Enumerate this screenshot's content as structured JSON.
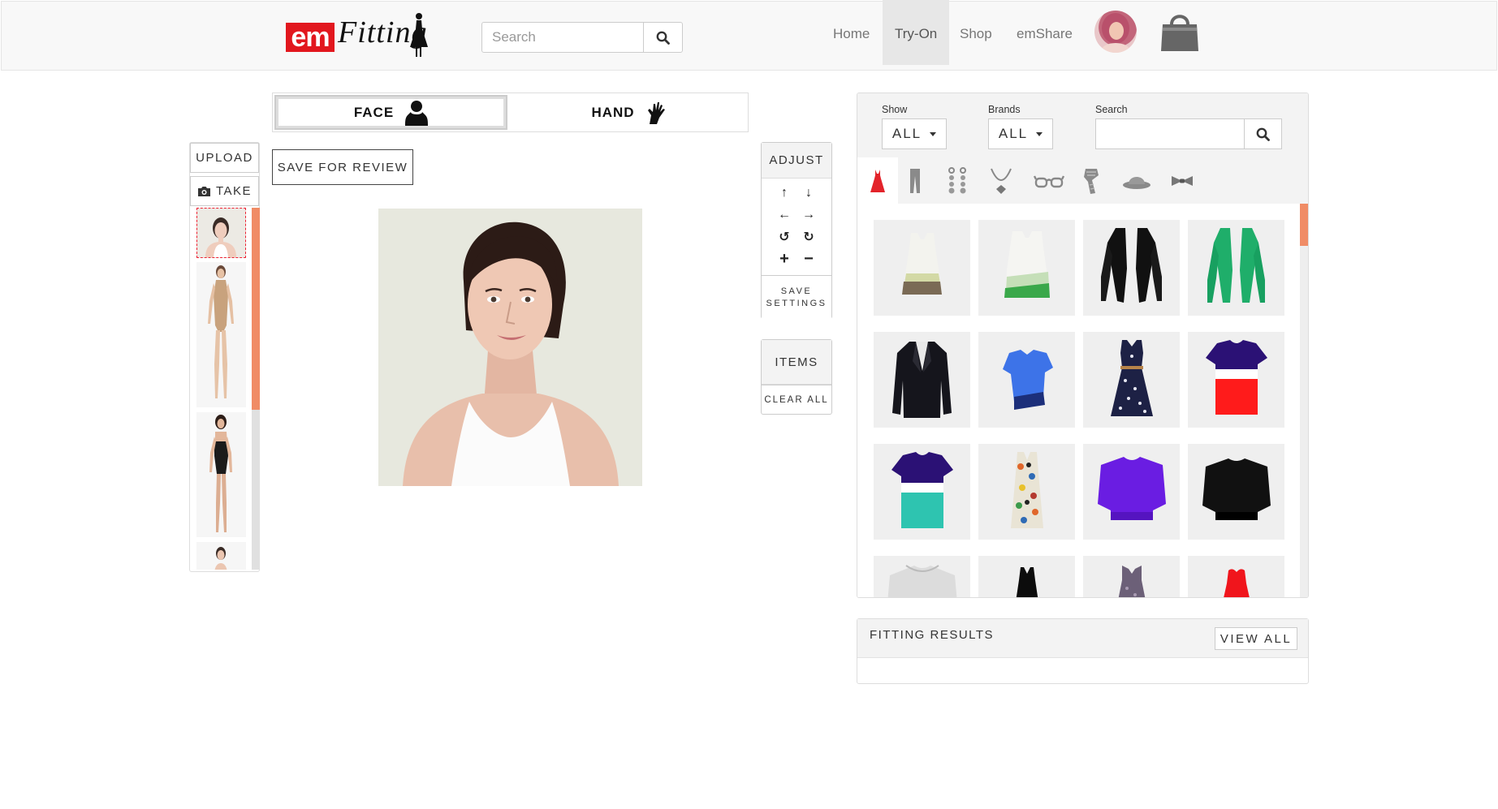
{
  "brand": {
    "logo_em": "em",
    "logo_fitting": "Fitting"
  },
  "search": {
    "placeholder": "Search"
  },
  "nav": {
    "items": [
      {
        "label": "Home",
        "active": false
      },
      {
        "label": "Try-On",
        "active": true
      },
      {
        "label": "Shop",
        "active": false
      },
      {
        "label": "emShare",
        "active": false
      }
    ]
  },
  "mode": {
    "face_label": "FACE",
    "hand_label": "HAND",
    "selected": "FACE"
  },
  "left_tools": {
    "upload_label": "UPLOAD",
    "take_label": "TAKE",
    "save_review_label": "SAVE FOR REVIEW"
  },
  "adjust": {
    "title": "ADJUST",
    "save_settings_line1": "SAVE",
    "save_settings_line2": "SETTINGS"
  },
  "items_panel": {
    "title": "ITEMS",
    "clear_all_label": "CLEAR ALL"
  },
  "filters": {
    "show_label": "Show",
    "show_value": "ALL",
    "brands_label": "Brands",
    "brands_value": "ALL",
    "search_label": "Search",
    "search_value": ""
  },
  "categories": [
    "dress-icon",
    "pants-icon",
    "earrings-icon",
    "necklace-icon",
    "glasses-icon",
    "scarf-icon",
    "hat-icon",
    "bowtie-icon"
  ],
  "results": {
    "title": "FITTING RESULTS",
    "view_all_label": "VIEW ALL"
  },
  "colors": {
    "accent": "#f08c66",
    "brand_red": "#e2171e",
    "panel_bg": "#f3f3f3"
  }
}
